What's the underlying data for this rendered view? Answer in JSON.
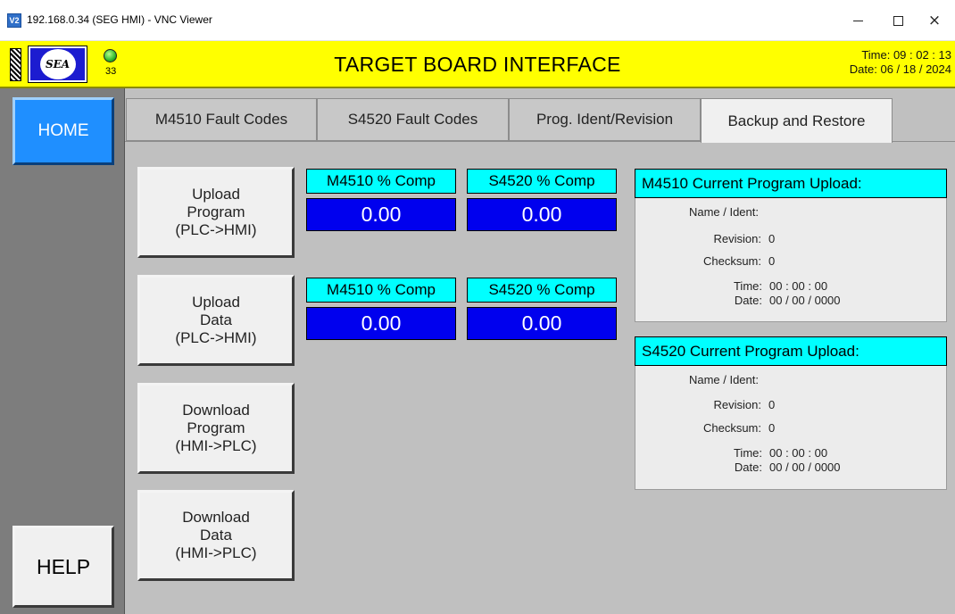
{
  "window": {
    "icon_text": "V2",
    "title": "192.168.0.34 (SEG HMI) - VNC Viewer",
    "minimize_label": "",
    "maximize_label": "",
    "close_label": "×"
  },
  "header": {
    "logo_text": "SEA",
    "status_count": "33",
    "title": "TARGET BOARD INTERFACE",
    "time": "Time: 09 : 02 : 13",
    "date": "Date: 06 / 18 / 2024",
    "colors": {
      "background": "#ffff00",
      "logo": "#1c1cd0",
      "led": "#2eb82e"
    }
  },
  "nav": {
    "home_label": "HOME",
    "help_label": "HELP"
  },
  "tabs": [
    {
      "label": "M4510 Fault Codes",
      "active": false
    },
    {
      "label": "S4520 Fault Codes",
      "active": false
    },
    {
      "label": "Prog. Ident/Revision",
      "active": false
    },
    {
      "label": "Backup and Restore",
      "active": true
    }
  ],
  "actions": [
    {
      "lines": [
        "Upload",
        "Program",
        "(PLC->HMI)"
      ]
    },
    {
      "lines": [
        "Upload",
        "Data",
        "(PLC->HMI)"
      ]
    },
    {
      "lines": [
        "Download",
        "Program",
        "(HMI->PLC)"
      ]
    },
    {
      "lines": [
        "Download",
        "Data",
        "(HMI->PLC)"
      ]
    }
  ],
  "progress": [
    {
      "label": "M4510 % Comp",
      "value": "0.00"
    },
    {
      "label": "S4520 % Comp",
      "value": "0.00"
    },
    {
      "label": "M4510 % Comp",
      "value": "0.00"
    },
    {
      "label": "S4520 % Comp",
      "value": "0.00"
    }
  ],
  "panels": [
    {
      "title": "M4510 Current Program Upload:",
      "name_label": "Name / Ident:",
      "name_value": "",
      "revision_label": "Revision:",
      "revision_value": "0",
      "checksum_label": "Checksum:",
      "checksum_value": "0",
      "time_label": "Time:",
      "time_value": "00 : 00 : 00",
      "date_label": "Date:",
      "date_value": "00 / 00 / 0000"
    },
    {
      "title": "S4520 Current Program Upload:",
      "name_label": "Name / Ident:",
      "name_value": "",
      "revision_label": "Revision:",
      "revision_value": "0",
      "checksum_label": "Checksum:",
      "checksum_value": "0",
      "time_label": "Time:",
      "time_value": "00 : 00 : 00",
      "date_label": "Date:",
      "date_value": "00 / 00 / 0000"
    }
  ],
  "colors": {
    "accent_cyan": "#00ffff",
    "value_blue": "#0000ee",
    "home_blue": "#1f8fff",
    "panel_gray": "#c0c0c0"
  }
}
